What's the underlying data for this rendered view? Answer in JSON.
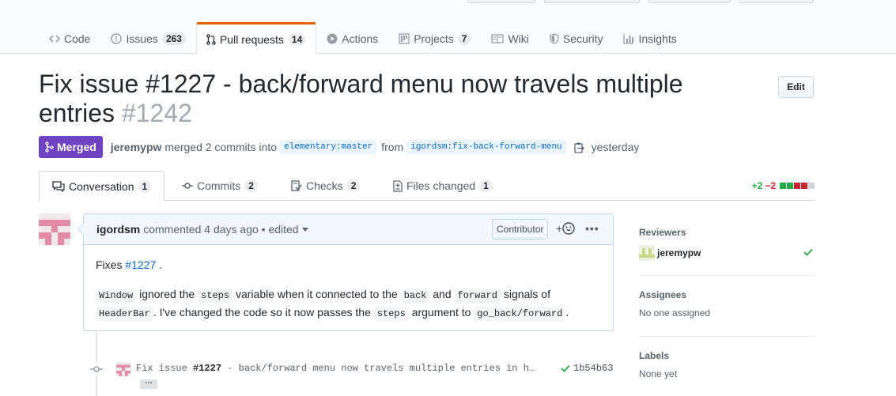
{
  "repo_nav": {
    "code": "Code",
    "issues": "Issues",
    "issues_count": "263",
    "pulls": "Pull requests",
    "pulls_count": "14",
    "actions": "Actions",
    "projects": "Projects",
    "projects_count": "7",
    "wiki": "Wiki",
    "security": "Security",
    "insights": "Insights"
  },
  "pr": {
    "title": "Fix issue #1227 - back/forward menu now travels multiple entries",
    "number": "#1242",
    "edit_label": "Edit",
    "state": "Merged",
    "merger": "jeremypw",
    "merged_text": "merged 2 commits into",
    "base_branch": "elementary:master",
    "from_text": "from",
    "head_branch": "igordsm:fix-back-forward-menu",
    "when": "yesterday"
  },
  "tabs": {
    "conversation": "Conversation",
    "conversation_count": "1",
    "commits": "Commits",
    "commits_count": "2",
    "checks": "Checks",
    "checks_count": "2",
    "files": "Files changed",
    "files_count": "1",
    "additions": "+2",
    "deletions": "−2"
  },
  "comment": {
    "author": "igordsm",
    "meta": "commented 4 days ago • edited",
    "badge": "Contributor",
    "reaction_plus": "+",
    "more": "•••",
    "line1_prefix": "Fixes",
    "line1_link": "#1227",
    "line1_suffix": ".",
    "c_window": "Window",
    "t_ignored": "ignored the",
    "c_steps": "steps",
    "t_variable": "variable when it connected to the",
    "c_back": "back",
    "t_and": "and",
    "c_forward": "forward",
    "t_signals": "signals of",
    "c_headerbar": "HeaderBar",
    "t_changed": ". I've changed the code so it now passes the",
    "c_steps2": "steps",
    "t_argument": "argument to",
    "c_goback": "go_back/forward",
    "t_end": "."
  },
  "commit": {
    "prefix": "Fix issue",
    "issue": "#1227",
    "rest": "- back/forward menu now travels multiple entries in h…",
    "sha": "1b54b63",
    "ellipsis": "…"
  },
  "sidebar": {
    "reviewers_heading": "Reviewers",
    "reviewer": "jeremypw",
    "assignees_heading": "Assignees",
    "assignees_value": "No one assigned",
    "labels_heading": "Labels",
    "labels_value": "None yet"
  },
  "colors": {
    "merged": "#6f42c1",
    "addition": "#28a745",
    "deletion": "#cb2431",
    "accent": "#e36209",
    "link": "#0366d6"
  }
}
